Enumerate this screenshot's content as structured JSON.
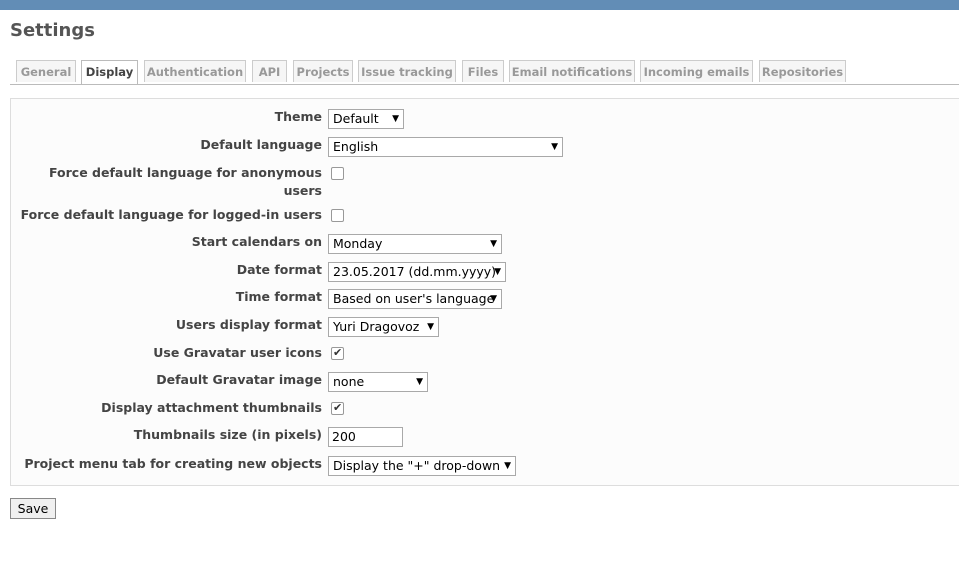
{
  "page": {
    "title": "Settings"
  },
  "tabs": [
    {
      "label": "General"
    },
    {
      "label": "Display",
      "selected": true
    },
    {
      "label": "Authentication"
    },
    {
      "label": "API"
    },
    {
      "label": "Projects"
    },
    {
      "label": "Issue tracking"
    },
    {
      "label": "Files"
    },
    {
      "label": "Email notifications"
    },
    {
      "label": "Incoming emails"
    },
    {
      "label": "Repositories"
    }
  ],
  "form": {
    "theme": {
      "label": "Theme",
      "value": "Default"
    },
    "default_language": {
      "label": "Default language",
      "value": "English"
    },
    "force_anonymous": {
      "label": "Force default language for anonymous users",
      "checked": false
    },
    "force_logged_in": {
      "label": "Force default language for logged-in users",
      "checked": false
    },
    "start_calendars": {
      "label": "Start calendars on",
      "value": "Monday"
    },
    "date_format": {
      "label": "Date format",
      "value": "23.05.2017 (dd.mm.yyyy)"
    },
    "time_format": {
      "label": "Time format",
      "value": "Based on user's language"
    },
    "users_display_format": {
      "label": "Users display format",
      "value": "Yuri Dragovoz"
    },
    "gravatar_icons": {
      "label": "Use Gravatar user icons",
      "checked": true
    },
    "gravatar_default": {
      "label": "Default Gravatar image",
      "value": "none"
    },
    "attachment_thumbnails": {
      "label": "Display attachment thumbnails",
      "checked": true
    },
    "thumbnails_size": {
      "label": "Thumbnails size (in pixels)",
      "value": "200"
    },
    "project_menu_tab": {
      "label": "Project menu tab for creating new objects",
      "value": "Display the \"+\" drop-down"
    }
  },
  "actions": {
    "save_label": "Save"
  },
  "icons": {
    "dropdown_arrow": "▼",
    "check_mark": "✔"
  },
  "colors": {
    "header_bar": "#628db6"
  }
}
